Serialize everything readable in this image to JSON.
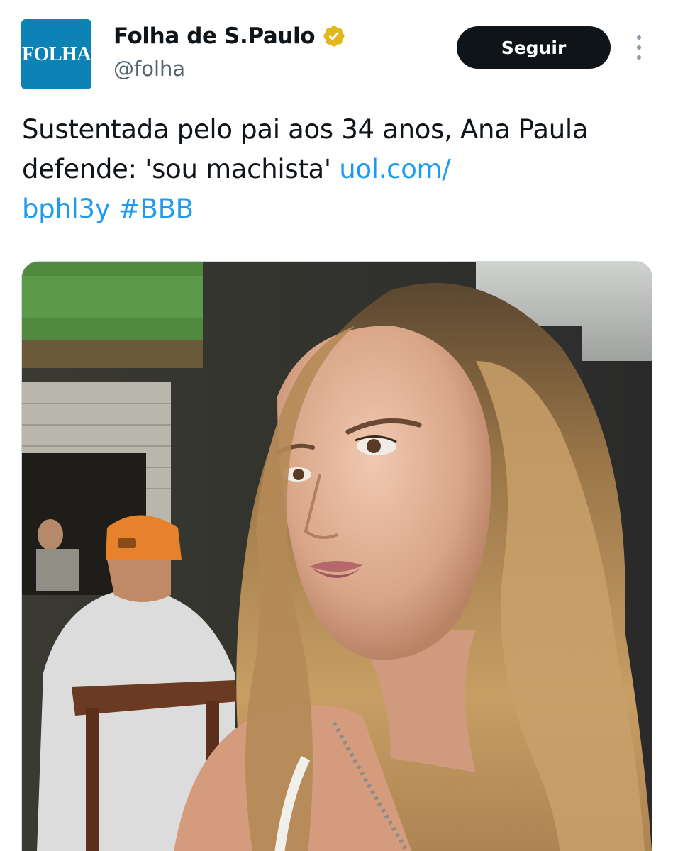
{
  "account": {
    "avatar_text": "FOLHA",
    "display_name": "Folha de S.Paulo",
    "handle": "@folha",
    "verified_icon": "gold-verified-badge-icon"
  },
  "actions": {
    "follow_label": "Seguir",
    "more_icon": "more-vertical-icon"
  },
  "tweet": {
    "text": "Sustentada pelo pai aos 34 anos, Ana Paula defende: 'sou machista' ",
    "link_text": "uol.com/bphl3y",
    "link_part1": "uol.com/",
    "link_part2": "bphl3y",
    "hashtag": "#BBB"
  },
  "media": {
    "kind": "photo"
  },
  "colors": {
    "link": "#1d9bf0",
    "text": "#0f1419",
    "secondary": "#536471",
    "button_bg": "#0f1419",
    "avatar_bg": "#0d83b5",
    "verified": "#e2b719"
  }
}
